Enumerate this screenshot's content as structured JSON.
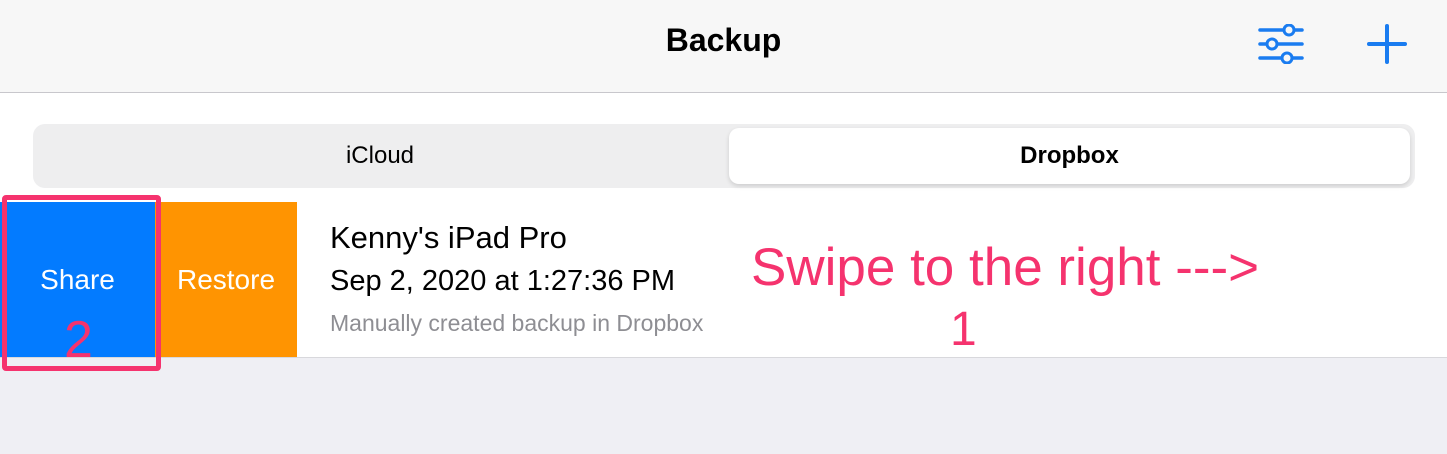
{
  "navbar": {
    "title": "Backup",
    "filter_icon": "sliders-icon",
    "add_icon": "plus-icon",
    "accent_color": "#1a7cf0"
  },
  "segmented_control": {
    "options": [
      "iCloud",
      "Dropbox"
    ],
    "selected": "Dropbox"
  },
  "backup_row": {
    "title": "Kenny's iPad Pro",
    "date": "Sep 2, 2020 at 1:27:36 PM",
    "subtitle": "Manually created backup in Dropbox",
    "actions": [
      {
        "label": "Share",
        "color": "#037bff"
      },
      {
        "label": "Restore",
        "color": "#ff9401"
      }
    ]
  },
  "annotations": {
    "color": "#f5336e",
    "swipe_text": "Swipe to the right --->",
    "step_1": "1",
    "step_2": "2"
  }
}
